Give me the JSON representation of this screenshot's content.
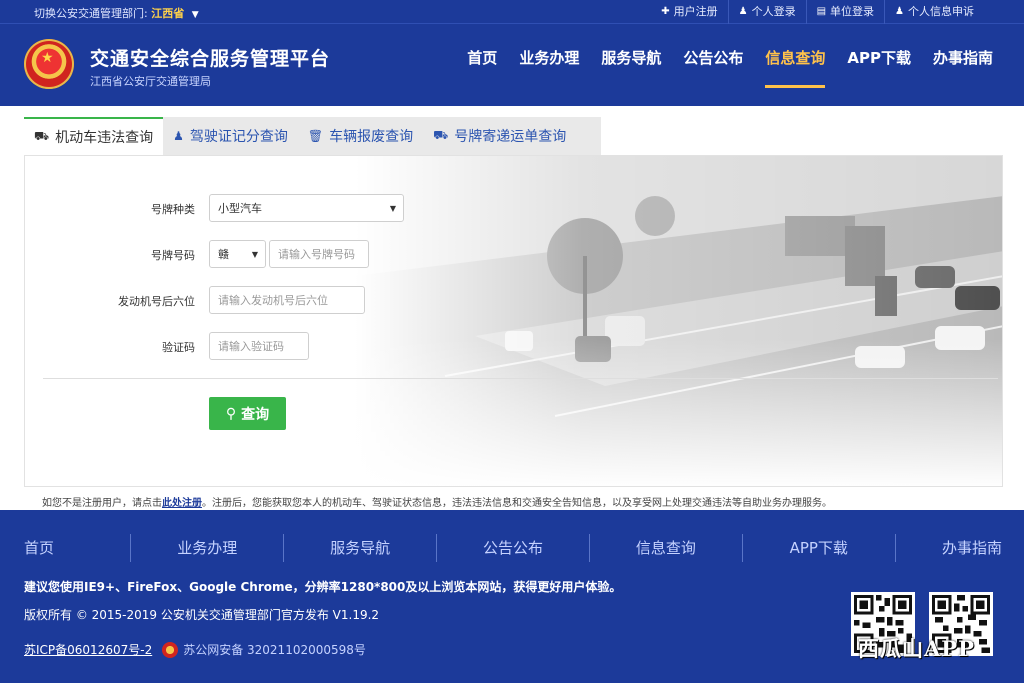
{
  "topbar": {
    "switch_label": "切换公安交通管理部门:",
    "province": "江西省",
    "links": [
      {
        "label": "用户注册",
        "icon": "plus-icon"
      },
      {
        "label": "个人登录",
        "icon": "user-icon"
      },
      {
        "label": "单位登录",
        "icon": "document-icon"
      },
      {
        "label": "个人信息申诉",
        "icon": "user-icon"
      }
    ]
  },
  "header": {
    "title": "交通安全综合服务管理平台",
    "subtitle": "江西省公安厅交通管理局",
    "nav": [
      "首页",
      "业务办理",
      "服务导航",
      "公告公布",
      "信息查询",
      "APP下载",
      "办事指南"
    ],
    "active_nav": "信息查询"
  },
  "tabs": [
    {
      "label": "机动车违法查询",
      "icon": "truck-icon",
      "active": true
    },
    {
      "label": "驾驶证记分查询",
      "icon": "person-icon",
      "active": false
    },
    {
      "label": "车辆报废查询",
      "icon": "trash-icon",
      "active": false
    },
    {
      "label": "号牌寄递运单查询",
      "icon": "truck-icon",
      "active": false
    }
  ],
  "form": {
    "plate_type_label": "号牌种类",
    "plate_type_value": "小型汽车",
    "plate_no_label": "号牌号码",
    "plate_prefix_value": "赣",
    "plate_no_placeholder": "请输入号牌号码",
    "engine_label": "发动机号后六位",
    "engine_placeholder": "请输入发动机号后六位",
    "captcha_label": "验证码",
    "captcha_placeholder": "请输入验证码",
    "query_button": "查询"
  },
  "notice": {
    "prefix": "如您不是注册用户，请点击",
    "link": "此处注册",
    "suffix": "。注册后，您能获取您本人的机动车、驾驶证状态信息，违法违法信息和交通安全告知信息，以及享受网上处理交通违法等自助业务办理服务。"
  },
  "footer": {
    "nav": [
      "首页",
      "业务办理",
      "服务导航",
      "公告公布",
      "信息查询",
      "APP下载",
      "办事指南"
    ],
    "browser_tip": "建议您使用IE9+、FireFox、Google Chrome，分辨率1280*800及以上浏览本网站，获得更好用户体验。",
    "copyright": "版权所有 © 2015-2019 公安机关交通管理部门官方发布 V1.19.2",
    "icp": "苏ICP备06012607号-2",
    "police_record": "苏公网安备 32021102000598号",
    "watermark": "西瓜山APP"
  },
  "colors": {
    "brand_blue": "#1c3a9a",
    "accent_yellow": "#ffc24a",
    "button_green": "#39b54a"
  }
}
